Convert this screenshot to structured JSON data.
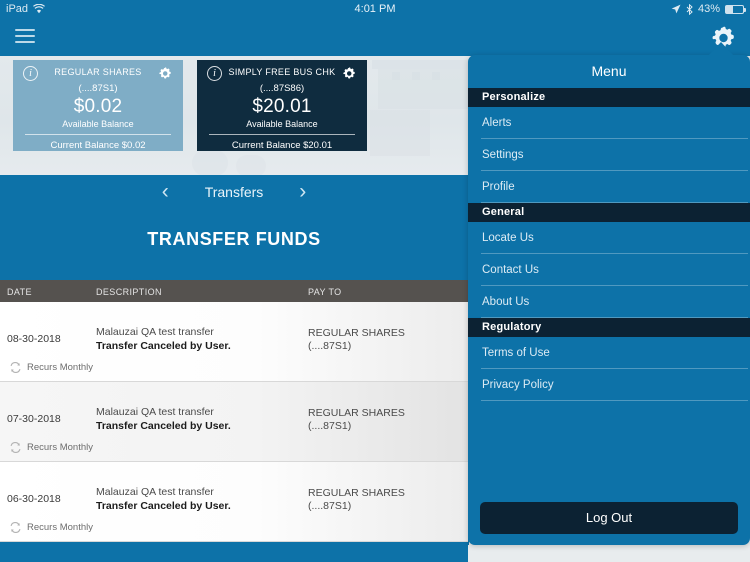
{
  "statusbar": {
    "device": "iPad",
    "wifi_icon": "wifi-icon",
    "time": "4:01 PM",
    "location_icon": "location-arrow-icon",
    "bluetooth_icon": "bluetooth-icon",
    "battery_percent": "43%",
    "battery_icon": "battery-icon"
  },
  "appbar": {
    "menu_icon": "hamburger-menu-icon",
    "settings_icon": "gear-icon"
  },
  "accounts": [
    {
      "name": "REGULAR SHARES",
      "number": "(....87S1)",
      "available": "$0.02",
      "available_label": "Available Balance",
      "current": "Current Balance $0.02",
      "info_icon": "info-icon",
      "gear_icon": "gear-icon",
      "bg": "#7fadc6"
    },
    {
      "name": "SIMPLY FREE BUS CHK",
      "number": "(....87S86)",
      "available": "$20.01",
      "available_label": "Available Balance",
      "current": "Current Balance $20.01",
      "info_icon": "info-icon",
      "gear_icon": "gear-icon",
      "bg": "#0f2c3f"
    }
  ],
  "page": {
    "nav_prev_icon": "chevron-left-icon",
    "nav_title": "Transfers",
    "nav_next_icon": "chevron-right-icon",
    "title": "TRANSFER FUNDS",
    "columns": {
      "date": "DATE",
      "description": "DESCRIPTION",
      "payto": "PAY TO"
    },
    "rows": [
      {
        "date": "08-30-2018",
        "description": "Malauzai QA test transfer",
        "status": "Transfer Canceled by User.",
        "payto": "REGULAR SHARES",
        "payto_account": "(....87S1)",
        "recurrence": "Recurs Monthly",
        "recurrence_icon": "repeat-icon"
      },
      {
        "date": "07-30-2018",
        "description": "Malauzai QA test transfer",
        "status": "Transfer Canceled by User.",
        "payto": "REGULAR SHARES",
        "payto_account": "(....87S1)",
        "recurrence": "Recurs Monthly",
        "recurrence_icon": "repeat-icon"
      },
      {
        "date": "06-30-2018",
        "description": "Malauzai QA test transfer",
        "status": "Transfer Canceled by User.",
        "payto": "REGULAR SHARES",
        "payto_account": "(....87S1)",
        "recurrence": "Recurs Monthly",
        "recurrence_icon": "repeat-icon"
      }
    ]
  },
  "menu": {
    "title": "Menu",
    "sections": [
      {
        "heading": "Personalize",
        "items": [
          "Alerts",
          "Settings",
          "Profile"
        ]
      },
      {
        "heading": "General",
        "items": [
          "Locate Us",
          "Contact Us",
          "About Us"
        ]
      },
      {
        "heading": "Regulatory",
        "items": [
          "Terms of Use",
          "Privacy Policy"
        ]
      }
    ],
    "logout_label": "Log Out"
  },
  "colors": {
    "brand_blue": "#0d72a8",
    "navy": "#0c2233",
    "card_light": "#7fadc6",
    "card_dark": "#0f2c3f",
    "table_header": "#55524f"
  }
}
